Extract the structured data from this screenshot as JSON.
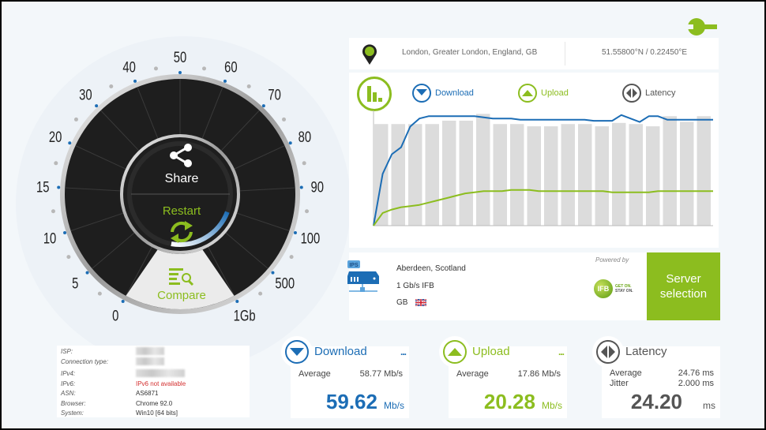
{
  "location": {
    "text": "London, Greater London, England, GB",
    "coords": "51.55800°N / 0.22450°E"
  },
  "icons": {
    "settings": "wrench-icon",
    "location": "map-pin-icon",
    "graph": "bar-chart-icon"
  },
  "dial": {
    "scale_labels": [
      "0",
      "5",
      "10",
      "15",
      "20",
      "30",
      "40",
      "50",
      "60",
      "70",
      "80",
      "90",
      "100",
      "500",
      "1Gb"
    ],
    "share_label": "Share",
    "restart_label": "Restart",
    "compare_label": "Compare",
    "progress_fraction": 0.22
  },
  "legend": {
    "download": "Download",
    "upload": "Upload",
    "latency": "Latency"
  },
  "chart_data": {
    "type": "line",
    "title": "",
    "xlabel": "",
    "ylabel": "",
    "grid": false,
    "legend_position": "top",
    "bars": {
      "name": "Latency",
      "count": 20,
      "values": [
        0.9,
        0.9,
        0.9,
        0.9,
        0.93,
        0.93,
        0.99,
        0.9,
        0.9,
        0.88,
        0.88,
        0.9,
        0.9,
        0.88,
        0.91,
        0.9,
        0.88,
        0.97,
        0.92,
        0.97
      ]
    },
    "series": [
      {
        "name": "Download",
        "color": "#1c6db5",
        "values": [
          0.0,
          0.45,
          0.62,
          0.68,
          0.86,
          0.93,
          0.95,
          0.95,
          0.95,
          0.95,
          0.95,
          0.95,
          0.94,
          0.93,
          0.93,
          0.93,
          0.92,
          0.92,
          0.92,
          0.92,
          0.92,
          0.92,
          0.92,
          0.92,
          0.91,
          0.91,
          0.91,
          0.96,
          0.93,
          0.9,
          0.95,
          0.95,
          0.92,
          0.92,
          0.92,
          0.92,
          0.92,
          0.92
        ]
      },
      {
        "name": "Upload",
        "color": "#8cbd1f",
        "values": [
          0.0,
          0.11,
          0.14,
          0.16,
          0.17,
          0.18,
          0.2,
          0.22,
          0.24,
          0.26,
          0.28,
          0.29,
          0.3,
          0.3,
          0.3,
          0.31,
          0.31,
          0.31,
          0.3,
          0.3,
          0.3,
          0.3,
          0.3,
          0.3,
          0.3,
          0.3,
          0.29,
          0.29,
          0.29,
          0.29,
          0.29,
          0.3,
          0.3,
          0.3,
          0.3,
          0.3,
          0.3,
          0.3
        ]
      }
    ],
    "ylim": [
      0,
      1
    ]
  },
  "server": {
    "badge": "IPS",
    "city": "Aberdeen, Scotland",
    "speed": "1 Gb/s IFB",
    "country": "GB",
    "powered_by": "Powered by",
    "provider_logo": "IFB",
    "provider_tag1": "GET ON.",
    "provider_tag2": "STAY ON.",
    "button_line1": "Server",
    "button_line2": "selection"
  },
  "info": {
    "rows": [
      {
        "key": "ISP:",
        "value": ""
      },
      {
        "key": "Connection type:",
        "value": ""
      },
      {
        "key": "IPv4:",
        "value": ""
      },
      {
        "key": "IPv6:",
        "value": "IPv6 not available"
      },
      {
        "key": "ASN:",
        "value": "AS6871"
      },
      {
        "key": "Browser:",
        "value": "Chrome 92.0"
      },
      {
        "key": "System:",
        "value": "Win10 [64 bits]"
      }
    ]
  },
  "download": {
    "title": "Download",
    "more": "...",
    "avg_label": "Average",
    "avg_value": "58.77 Mb/s",
    "value": "59.62",
    "unit": "Mb/s"
  },
  "upload": {
    "title": "Upload",
    "more": "...",
    "avg_label": "Average",
    "avg_value": "17.86 Mb/s",
    "value": "20.28",
    "unit": "Mb/s"
  },
  "latency": {
    "title": "Latency",
    "avg_label": "Average",
    "avg_value": "24.76 ms",
    "jitter_label": "Jitter",
    "jitter_value": "2.000 ms",
    "value": "24.20",
    "unit": "ms"
  },
  "colors": {
    "accent_green": "#8cbd1f",
    "download_blue": "#1c6db5",
    "latency_gray": "#555555",
    "error_red": "#d32f2f",
    "dial_black": "#1e1e1e"
  }
}
